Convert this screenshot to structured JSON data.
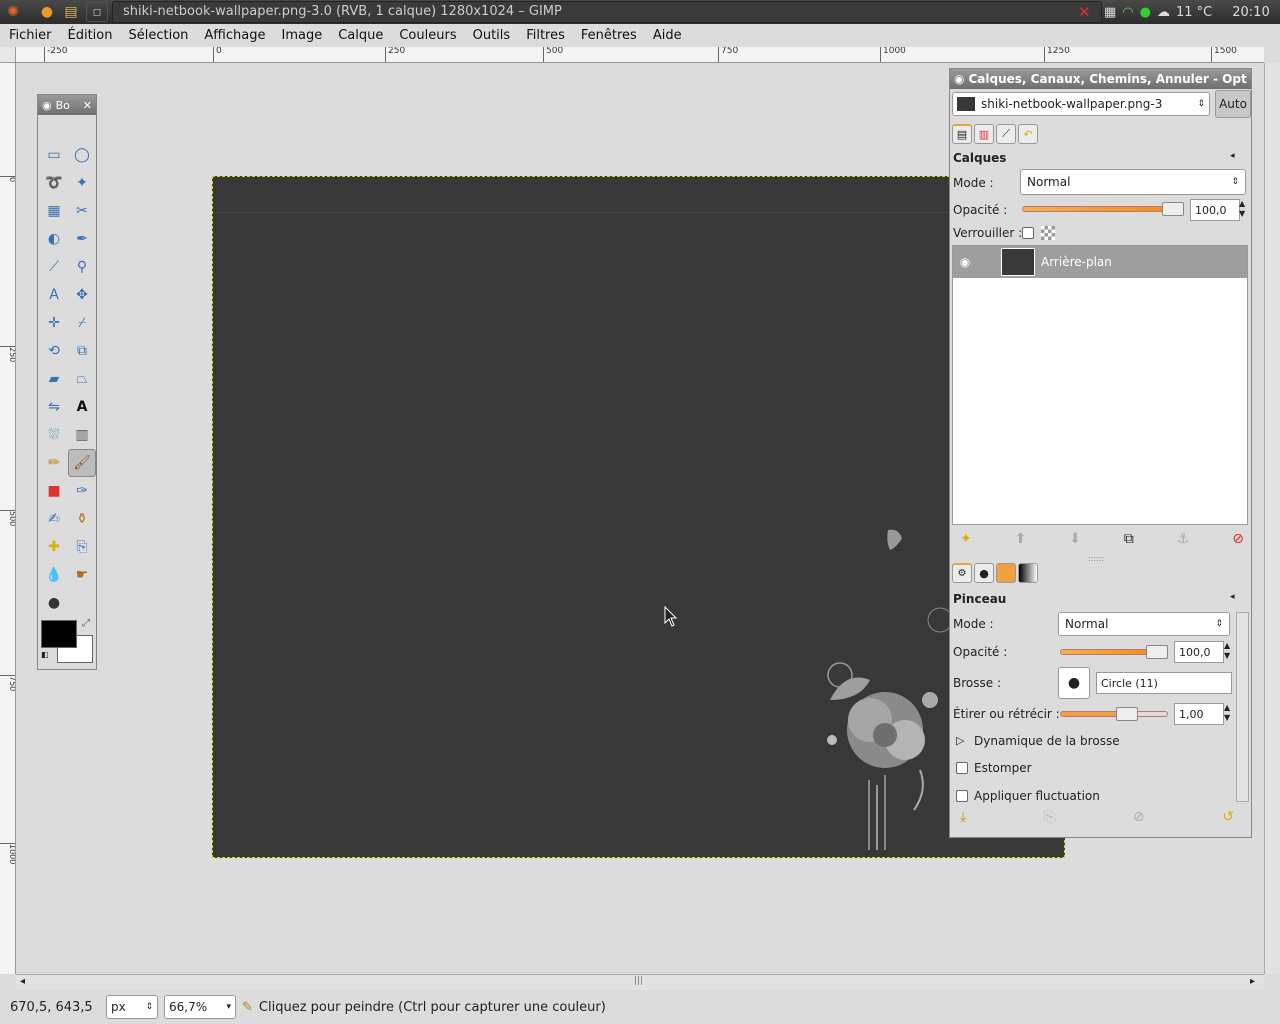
{
  "topbar": {
    "window_title": "shiki-netbook-wallpaper.png-3.0 (RVB, 1 calque) 1280x1024 – GIMP",
    "temperature": "11 °C",
    "time": "20:10"
  },
  "menubar": {
    "items": [
      "Fichier",
      "Édition",
      "Sélection",
      "Affichage",
      "Image",
      "Calque",
      "Couleurs",
      "Outils",
      "Filtres",
      "Fenêtres",
      "Aide"
    ]
  },
  "rulers": {
    "horizontal": [
      "-250",
      "0",
      "250",
      "500",
      "750",
      "1000",
      "1250",
      "1500"
    ],
    "vertical": [
      "0",
      "250",
      "500",
      "750",
      "1000"
    ]
  },
  "toolbox": {
    "title": "Bo"
  },
  "dock": {
    "title": "Calques, Canaux, Chemins, Annuler - Opt",
    "image_selector": "shiki-netbook-wallpaper.png-3",
    "auto_button": "Auto",
    "layers": {
      "panel_title": "Calques",
      "mode_label": "Mode :",
      "mode_value": "Normal",
      "opacity_label": "Opacité :",
      "opacity_value": "100,0",
      "lock_label": "Verrouiller :",
      "layer_name": "Arrière-plan"
    },
    "brush": {
      "panel_title": "Pinceau",
      "mode_label": "Mode :",
      "mode_value": "Normal",
      "opacity_label": "Opacité :",
      "opacity_value": "100,0",
      "brush_label": "Brosse :",
      "brush_value": "Circle (11)",
      "scale_label": "Étirer ou rétrécir :",
      "scale_value": "1,00",
      "dynamics_label": "Dynamique de la brosse",
      "fade_label": "Estomper",
      "jitter_label": "Appliquer fluctuation"
    }
  },
  "statusbar": {
    "coords": "670,5, 643,5",
    "unit": "px",
    "zoom": "66,7%",
    "message": "Cliquez pour peindre (Ctrl pour capturer une couleur)"
  }
}
